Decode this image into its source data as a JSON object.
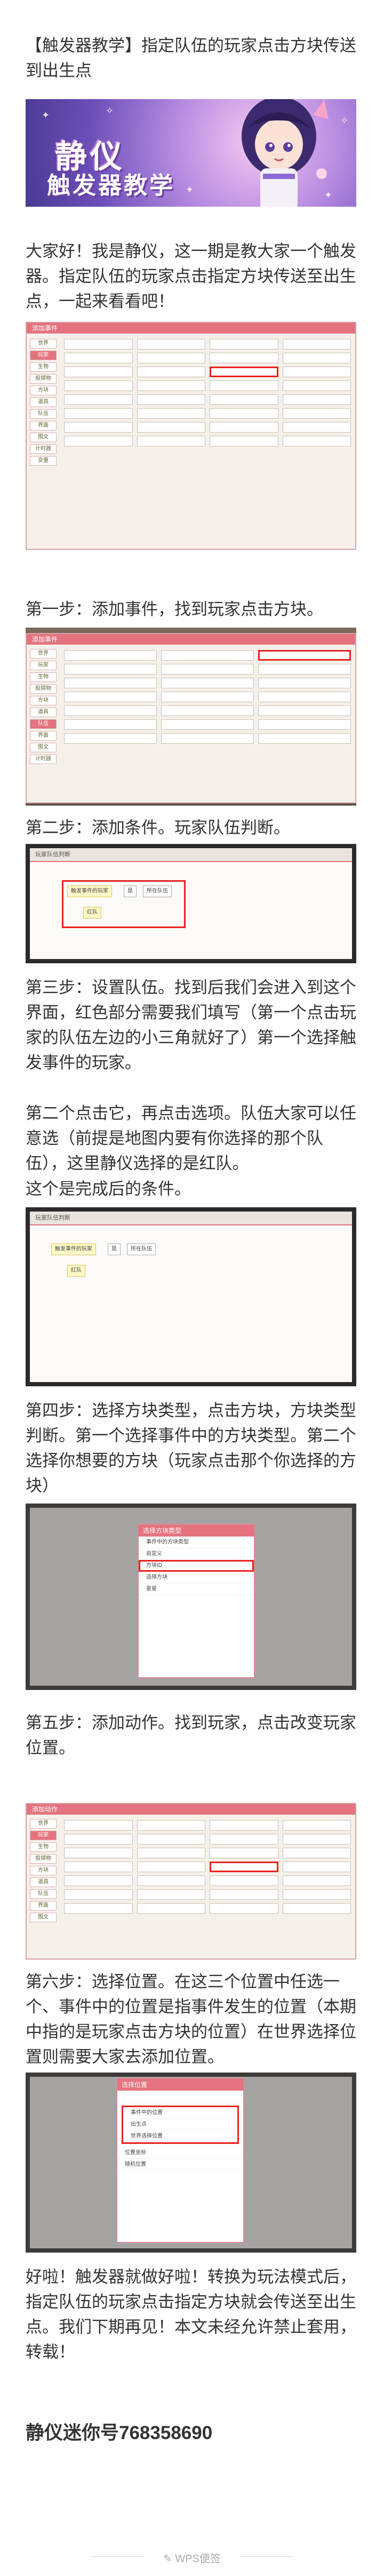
{
  "article": {
    "title": "【触发器教学】指定队伍的玩家点击方块传送到出生点",
    "intro": "大家好！我是静仪，这一期是教大家一个触发器。指定队伍的玩家点击指定方块传送至出生点，一起来看看吧！",
    "step1": "第一步：添加事件，找到玩家点击方块。",
    "step2": "第二步：添加条件。玩家队伍判断。",
    "step3": "第三步：设置队伍。找到后我们会进入到这个界面，红色部分需要我们填写（第一个点击玩家的队伍左边的小三角就好了）第一个选择触发事件的玩家。",
    "step3b": "第二个点击它，再点击选项。队伍大家可以任意选（前提是地图内要有你选择的那个队伍），这里静仪选择的是红队。",
    "step3c": "这个是完成后的条件。",
    "step4": "第四步：选择方块类型，点击方块，方块类型判断。第一个选择事件中的方块类型。第二个选择你想要的方块（玩家点击那个你选择的方块）",
    "step5": "第五步：添加动作。找到玩家，点击改变玩家位置。",
    "step6": "第六步：选择位置。在这三个位置中任选一个、事件中的位置是指事件发生的位置（本期中指的是玩家点击方块的位置）在世界选择位置则需要大家去添加位置。",
    "outro": "好啦！触发器就做好啦！转换为玩法模式后，指定队伍的玩家点击指定方块就会传送至出生点。我们下期再见！本文未经允许禁止套用，转载！",
    "signoff": "静仪迷你号768358690"
  },
  "banner": {
    "line1": "静仪",
    "line2": "触发器教学"
  },
  "footer": {
    "brand": "WPS便签"
  },
  "colors": {
    "accent": "#e4737f",
    "highlight": "#e8221f"
  },
  "screens": {
    "add_event_title": "添加事件",
    "condition_title": "玩家队伍判断",
    "select_type_title": "选择方块类型",
    "add_action_title": "添加动作",
    "select_pos_title": "选择位置",
    "menu_items": [
      "世界",
      "玩家",
      "生物",
      "投掷物",
      "方块",
      "道具",
      "队伍",
      "界面",
      "图文",
      "计时器",
      "变量"
    ],
    "chips": [
      "触发事件的玩家",
      "是",
      "所在队伍",
      "红队"
    ],
    "popup_type_rows": [
      "选择方块类型",
      "事件中的方块类型",
      "自定义",
      "方块ID",
      "选择方块",
      "星星"
    ],
    "popup_pos_rows": [
      "选择位置",
      "事件中的位置",
      "出生点",
      "世界选择位置",
      "位置坐标",
      "随机位置"
    ]
  }
}
